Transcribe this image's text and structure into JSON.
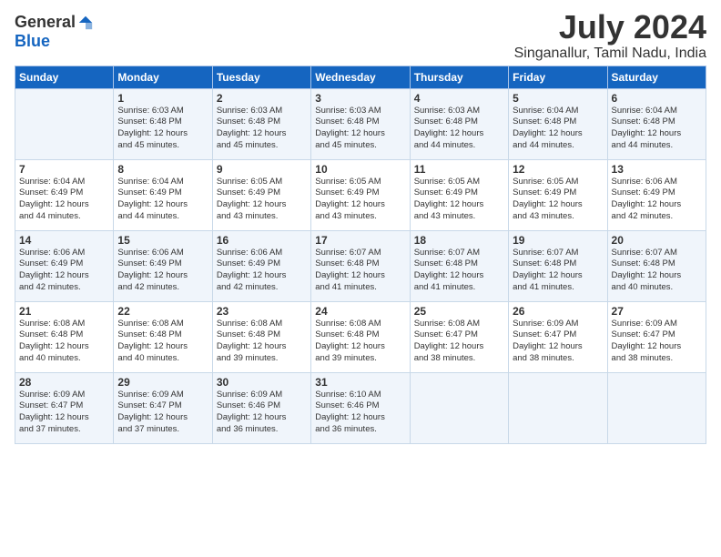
{
  "logo": {
    "general": "General",
    "blue": "Blue"
  },
  "header": {
    "month_year": "July 2024",
    "location": "Singanallur, Tamil Nadu, India"
  },
  "weekdays": [
    "Sunday",
    "Monday",
    "Tuesday",
    "Wednesday",
    "Thursday",
    "Friday",
    "Saturday"
  ],
  "weeks": [
    [
      {
        "day": "",
        "info": ""
      },
      {
        "day": "1",
        "info": "Sunrise: 6:03 AM\nSunset: 6:48 PM\nDaylight: 12 hours\nand 45 minutes."
      },
      {
        "day": "2",
        "info": "Sunrise: 6:03 AM\nSunset: 6:48 PM\nDaylight: 12 hours\nand 45 minutes."
      },
      {
        "day": "3",
        "info": "Sunrise: 6:03 AM\nSunset: 6:48 PM\nDaylight: 12 hours\nand 45 minutes."
      },
      {
        "day": "4",
        "info": "Sunrise: 6:03 AM\nSunset: 6:48 PM\nDaylight: 12 hours\nand 44 minutes."
      },
      {
        "day": "5",
        "info": "Sunrise: 6:04 AM\nSunset: 6:48 PM\nDaylight: 12 hours\nand 44 minutes."
      },
      {
        "day": "6",
        "info": "Sunrise: 6:04 AM\nSunset: 6:48 PM\nDaylight: 12 hours\nand 44 minutes."
      }
    ],
    [
      {
        "day": "7",
        "info": ""
      },
      {
        "day": "8",
        "info": "Sunrise: 6:04 AM\nSunset: 6:49 PM\nDaylight: 12 hours\nand 44 minutes."
      },
      {
        "day": "9",
        "info": "Sunrise: 6:05 AM\nSunset: 6:49 PM\nDaylight: 12 hours\nand 43 minutes."
      },
      {
        "day": "10",
        "info": "Sunrise: 6:05 AM\nSunset: 6:49 PM\nDaylight: 12 hours\nand 43 minutes."
      },
      {
        "day": "11",
        "info": "Sunrise: 6:05 AM\nSunset: 6:49 PM\nDaylight: 12 hours\nand 43 minutes."
      },
      {
        "day": "12",
        "info": "Sunrise: 6:05 AM\nSunset: 6:49 PM\nDaylight: 12 hours\nand 43 minutes."
      },
      {
        "day": "13",
        "info": "Sunrise: 6:06 AM\nSunset: 6:49 PM\nDaylight: 12 hours\nand 42 minutes."
      }
    ],
    [
      {
        "day": "14",
        "info": ""
      },
      {
        "day": "15",
        "info": "Sunrise: 6:06 AM\nSunset: 6:49 PM\nDaylight: 12 hours\nand 42 minutes."
      },
      {
        "day": "16",
        "info": "Sunrise: 6:06 AM\nSunset: 6:49 PM\nDaylight: 12 hours\nand 42 minutes."
      },
      {
        "day": "17",
        "info": "Sunrise: 6:07 AM\nSunset: 6:48 PM\nDaylight: 12 hours\nand 41 minutes."
      },
      {
        "day": "18",
        "info": "Sunrise: 6:07 AM\nSunset: 6:48 PM\nDaylight: 12 hours\nand 41 minutes."
      },
      {
        "day": "19",
        "info": "Sunrise: 6:07 AM\nSunset: 6:48 PM\nDaylight: 12 hours\nand 41 minutes."
      },
      {
        "day": "20",
        "info": "Sunrise: 6:07 AM\nSunset: 6:48 PM\nDaylight: 12 hours\nand 40 minutes."
      }
    ],
    [
      {
        "day": "21",
        "info": ""
      },
      {
        "day": "22",
        "info": "Sunrise: 6:08 AM\nSunset: 6:48 PM\nDaylight: 12 hours\nand 40 minutes."
      },
      {
        "day": "23",
        "info": "Sunrise: 6:08 AM\nSunset: 6:48 PM\nDaylight: 12 hours\nand 39 minutes."
      },
      {
        "day": "24",
        "info": "Sunrise: 6:08 AM\nSunset: 6:48 PM\nDaylight: 12 hours\nand 39 minutes."
      },
      {
        "day": "25",
        "info": "Sunrise: 6:08 AM\nSunset: 6:47 PM\nDaylight: 12 hours\nand 38 minutes."
      },
      {
        "day": "26",
        "info": "Sunrise: 6:09 AM\nSunset: 6:47 PM\nDaylight: 12 hours\nand 38 minutes."
      },
      {
        "day": "27",
        "info": "Sunrise: 6:09 AM\nSunset: 6:47 PM\nDaylight: 12 hours\nand 38 minutes."
      }
    ],
    [
      {
        "day": "28",
        "info": "Sunrise: 6:09 AM\nSunset: 6:47 PM\nDaylight: 12 hours\nand 37 minutes."
      },
      {
        "day": "29",
        "info": "Sunrise: 6:09 AM\nSunset: 6:47 PM\nDaylight: 12 hours\nand 37 minutes."
      },
      {
        "day": "30",
        "info": "Sunrise: 6:09 AM\nSunset: 6:46 PM\nDaylight: 12 hours\nand 36 minutes."
      },
      {
        "day": "31",
        "info": "Sunrise: 6:10 AM\nSunset: 6:46 PM\nDaylight: 12 hours\nand 36 minutes."
      },
      {
        "day": "",
        "info": ""
      },
      {
        "day": "",
        "info": ""
      },
      {
        "day": "",
        "info": ""
      }
    ]
  ],
  "week7_sunday": "Sunrise: 6:04 AM\nSunset: 6:49 PM\nDaylight: 12 hours\nand 44 minutes.",
  "week14_sunday": "Sunrise: 6:06 AM\nSunset: 6:49 PM\nDaylight: 12 hours\nand 42 minutes.",
  "week21_sunday": "Sunrise: 6:08 AM\nSunset: 6:48 PM\nDaylight: 12 hours\nand 40 minutes."
}
